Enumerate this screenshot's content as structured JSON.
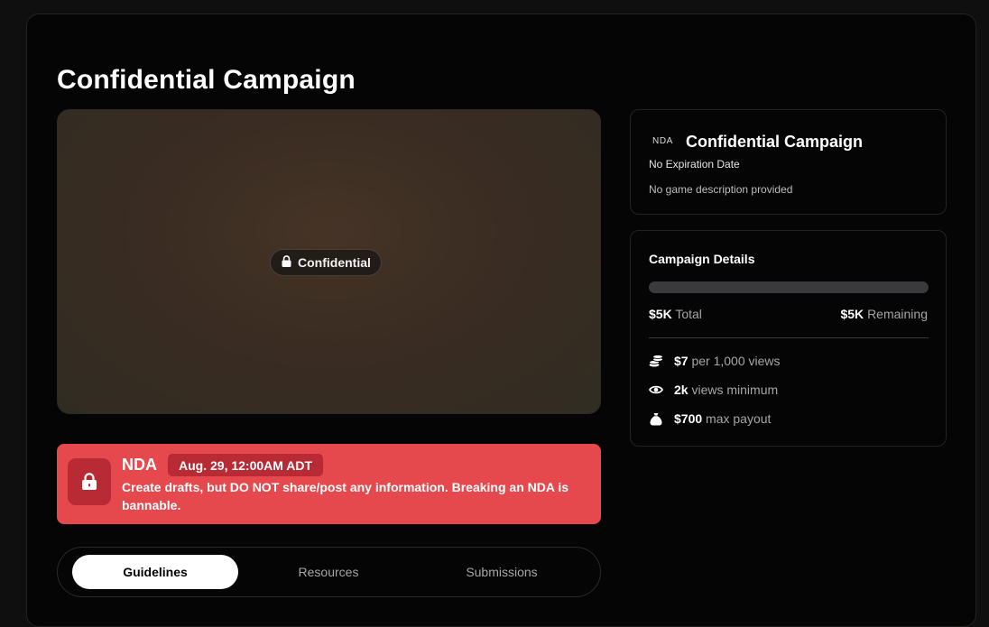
{
  "page": {
    "title": "Confidential Campaign"
  },
  "hero": {
    "badge_label": "Confidential"
  },
  "nda": {
    "title": "NDA",
    "date": "Aug. 29, 12:00AM ADT",
    "message": "Create drafts, but DO NOT share/post any information. Breaking an NDA is bannable.",
    "accent_color": "#e5484d"
  },
  "tabs": [
    {
      "label": "Guidelines",
      "active": true
    },
    {
      "label": "Resources",
      "active": false
    },
    {
      "label": "Submissions",
      "active": false
    }
  ],
  "info_card": {
    "logo_text": "NDA",
    "title": "Confidential Campaign",
    "expiration": "No Expiration Date",
    "description": "No game description provided"
  },
  "details": {
    "title": "Campaign Details",
    "progress_fraction": 0,
    "total_amount": "$5K",
    "total_label": "Total",
    "remaining_amount": "$5K",
    "remaining_label": "Remaining",
    "stats": [
      {
        "icon": "coins-icon",
        "value": "$7",
        "label": "per 1,000 views"
      },
      {
        "icon": "eye-icon",
        "value": "2k",
        "label": "views minimum"
      },
      {
        "icon": "money-bag-icon",
        "value": "$700",
        "label": "max payout"
      }
    ]
  }
}
